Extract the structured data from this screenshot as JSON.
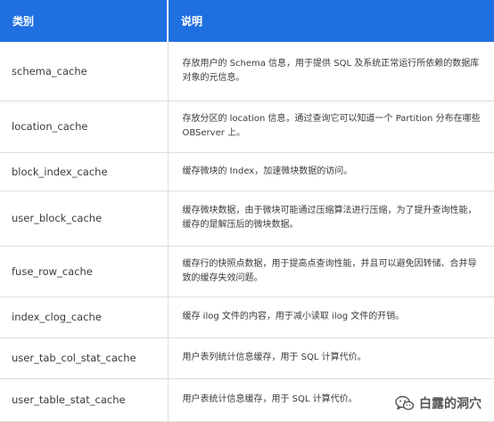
{
  "table": {
    "headers": [
      "类别",
      "说明"
    ],
    "rows": [
      {
        "name": "schema_cache",
        "desc": "存放用户的 Schema 信息，用于提供 SQL 及系统正常运行所依赖的数据库对象的元信息。"
      },
      {
        "name": "location_cache",
        "desc": "存放分区的 location 信息，通过查询它可以知道一个 Partition 分布在哪些 OBServer 上。"
      },
      {
        "name": "block_index_cache",
        "desc": "缓存微块的 Index，加速微块数据的访问。"
      },
      {
        "name": "user_block_cache",
        "desc": "缓存微块数据，由于微块可能通过压缩算法进行压缩，为了提升查询性能，缓存的是解压后的微块数据。"
      },
      {
        "name": "fuse_row_cache",
        "desc": "缓存行的快照点数据，用于提高点查询性能，并且可以避免因转储、合并导致的缓存失效问题。"
      },
      {
        "name": "index_clog_cache",
        "desc": "缓存 ilog 文件的内容，用于减小读取 ilog 文件的开销。"
      },
      {
        "name": "user_tab_col_stat_cache",
        "desc": "用户表列统计信息缓存，用于 SQL 计算代价。"
      },
      {
        "name": "user_table_stat_cache",
        "desc": "用户表统计信息缓存，用于 SQL 计算代价。"
      }
    ]
  },
  "watermark": {
    "text": "白露的洞穴",
    "icon": "wechat-icon"
  },
  "colors": {
    "header_bg": "#1f6fe0",
    "header_text": "#ffffff",
    "border": "#dcdcdc",
    "text": "#3b3b3b"
  }
}
